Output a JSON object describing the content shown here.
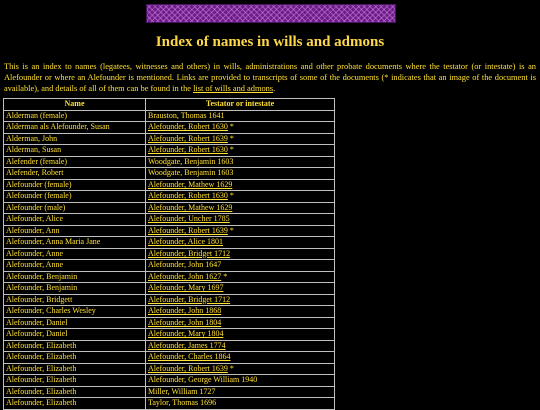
{
  "page": {
    "title": "Index of names in wills and admons",
    "intro_text": "This is an index to names (legatees, witnesses and others) in wills, administrations and other probate documents where the testator (or intestate) is an Alefounder or where an Alefounder is mentioned. Links are provided to transcripts of some of the documents (* indicates that an image of the document is available), and details of all of them can be found in the ",
    "intro_link": "list of wills and admons",
    "intro_end": "."
  },
  "table": {
    "headers": [
      "Name",
      "Testator or intestate"
    ],
    "rows": [
      {
        "name": "Alderman (female)",
        "testator": "Brauston, Thomas 1641",
        "link": false,
        "star": ""
      },
      {
        "name": "Alderman als Alefounder, Susan",
        "testator": "Alefounder, Robert 1630",
        "link": true,
        "star": " *"
      },
      {
        "name": "Alderman, John",
        "testator": "Alefounder, Robert 1639",
        "link": true,
        "star": " *"
      },
      {
        "name": "Alderman, Susan",
        "testator": "Alefounder, Robert 1630",
        "link": true,
        "star": " *"
      },
      {
        "name": "Alefender (female)",
        "testator": "Woodgate, Benjamin 1603",
        "link": false,
        "star": ""
      },
      {
        "name": "Alefender, Robert",
        "testator": "Woodgate, Benjamin 1603",
        "link": false,
        "star": ""
      },
      {
        "name": "Alefounder (female)",
        "testator": "Alefounder, Mathew 1629",
        "link": true,
        "star": ""
      },
      {
        "name": "Alefounder (female)",
        "testator": "Alefounder, Robert 1630",
        "link": true,
        "star": " *"
      },
      {
        "name": "Alefounder (male)",
        "testator": "Alefounder, Mathew 1629",
        "link": true,
        "star": ""
      },
      {
        "name": "Alefounder, Alice",
        "testator": "Alefounder, Uncher 1785",
        "link": true,
        "star": ""
      },
      {
        "name": "Alefounder, Ann",
        "testator": "Alefounder, Robert 1639",
        "link": true,
        "star": " *"
      },
      {
        "name": "Alefounder, Anna Maria Jane",
        "testator": "Alefounder, Alice 1801",
        "link": true,
        "star": ""
      },
      {
        "name": "Alefounder, Anne",
        "testator": "Alefounder, Bridget 1712",
        "link": true,
        "star": ""
      },
      {
        "name": "Alefounder, Anne",
        "testator": "Alefounder, John 1647",
        "link": false,
        "star": ""
      },
      {
        "name": "Alefounder, Benjamin",
        "testator": "Alefounder, John 1627",
        "link": true,
        "star": " *"
      },
      {
        "name": "Alefounder, Benjamin",
        "testator": "Alefounder, Mary 1697",
        "link": true,
        "star": ""
      },
      {
        "name": "Alefounder, Bridgett",
        "testator": "Alefounder, Bridget 1712",
        "link": true,
        "star": ""
      },
      {
        "name": "Alefounder, Charles Wesley",
        "testator": "Alefounder, John 1868",
        "link": true,
        "star": ""
      },
      {
        "name": "Alefounder, Daniel",
        "testator": "Alefounder, John 1804",
        "link": true,
        "star": ""
      },
      {
        "name": "Alefounder, Daniel",
        "testator": "Alefounder, Mary 1804",
        "link": true,
        "star": ""
      },
      {
        "name": "Alefounder, Elizabeth",
        "testator": "Alefounder, James 1774",
        "link": true,
        "star": ""
      },
      {
        "name": "Alefounder, Elizabeth",
        "testator": "Alefounder, Charles 1864",
        "link": true,
        "star": ""
      },
      {
        "name": "Alefounder, Elizabeth",
        "testator": "Alefounder, Robert 1639",
        "link": true,
        "star": " *"
      },
      {
        "name": "Alefounder, Elizabeth",
        "testator": "Alefounder, George William 1940",
        "link": false,
        "star": ""
      },
      {
        "name": "Alefounder, Elizabeth",
        "testator": "Miller, William 1727",
        "link": false,
        "star": ""
      },
      {
        "name": "Alefounder, Elizabeth",
        "testator": "Taylor, Thomas 1696",
        "link": false,
        "star": ""
      }
    ]
  }
}
